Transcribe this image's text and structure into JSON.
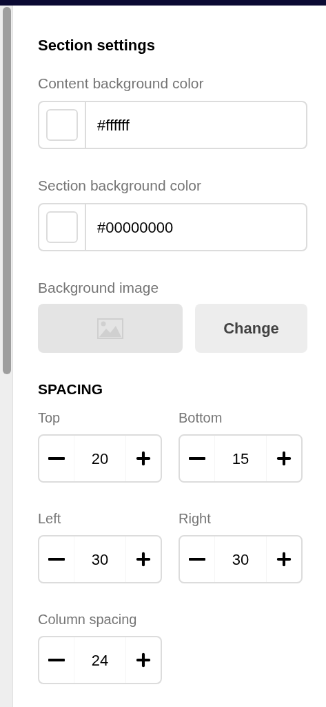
{
  "title": "Section settings",
  "color_fields": [
    {
      "label": "Content background color",
      "value": "#ffffff"
    },
    {
      "label": "Section background color",
      "value": "#00000000"
    }
  ],
  "background_image": {
    "label": "Background image",
    "button": "Change"
  },
  "spacing": {
    "title": "SPACING",
    "steppers": [
      {
        "label": "Top",
        "value": "20"
      },
      {
        "label": "Bottom",
        "value": "15"
      },
      {
        "label": "Left",
        "value": "30"
      },
      {
        "label": "Right",
        "value": "30"
      },
      {
        "label": "Column spacing",
        "value": "24"
      }
    ]
  }
}
